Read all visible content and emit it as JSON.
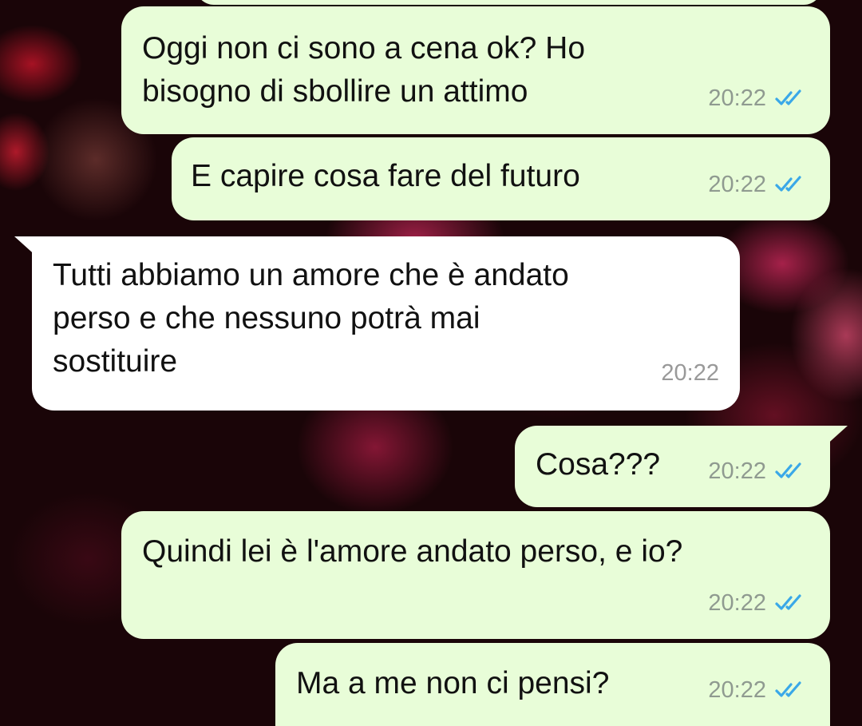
{
  "chat": {
    "accent_tick_color": "#3aa8e8",
    "outgoing_bubble_color": "#e8fdd8",
    "incoming_bubble_color": "#ffffff",
    "messages": [
      {
        "direction": "out",
        "text": "Oggi non ci sono a cena ok? Ho\nbisogno di sbollire un attimo",
        "time": "20:22",
        "status": "read",
        "status_icon": "double-check-icon"
      },
      {
        "direction": "out",
        "text": "E capire cosa fare del futuro",
        "time": "20:22",
        "status": "read",
        "status_icon": "double-check-icon"
      },
      {
        "direction": "in",
        "text": "Tutti abbiamo un amore che è andato\nperso e che nessuno potrà mai\nsostituire",
        "time": "20:22"
      },
      {
        "direction": "out",
        "text": "Cosa???",
        "time": "20:22",
        "status": "read",
        "status_icon": "double-check-icon"
      },
      {
        "direction": "out",
        "text": "Quindi lei è l'amore andato perso, e io?",
        "time": "20:22",
        "status": "read",
        "status_icon": "double-check-icon"
      },
      {
        "direction": "out",
        "text": "Ma a me non ci pensi?",
        "time": "20:22",
        "status": "read",
        "status_icon": "double-check-icon"
      }
    ]
  }
}
